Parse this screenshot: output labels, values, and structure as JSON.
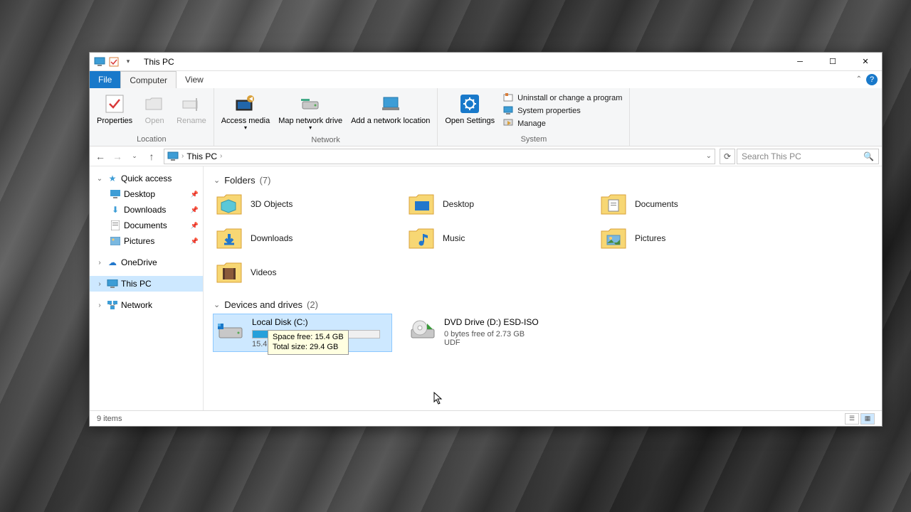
{
  "title": "This PC",
  "tabs": {
    "file": "File",
    "computer": "Computer",
    "view": "View"
  },
  "ribbon": {
    "location": {
      "label": "Location",
      "properties": "Properties",
      "open": "Open",
      "rename": "Rename"
    },
    "network": {
      "label": "Network",
      "access_media": "Access media",
      "map_drive": "Map network drive",
      "add_loc": "Add a network location"
    },
    "system": {
      "label": "System",
      "open_settings": "Open Settings",
      "uninstall": "Uninstall or change a program",
      "sys_props": "System properties",
      "manage": "Manage"
    }
  },
  "breadcrumb": "This PC",
  "search_placeholder": "Search This PC",
  "sidebar": {
    "quick_access": "Quick access",
    "desktop": "Desktop",
    "downloads": "Downloads",
    "documents": "Documents",
    "pictures": "Pictures",
    "onedrive": "OneDrive",
    "this_pc": "This PC",
    "network": "Network"
  },
  "sections": {
    "folders": {
      "label": "Folders",
      "count": "(7)"
    },
    "drives": {
      "label": "Devices and drives",
      "count": "(2)"
    }
  },
  "folders": {
    "f0": "3D Objects",
    "f1": "Desktop",
    "f2": "Documents",
    "f3": "Downloads",
    "f4": "Music",
    "f5": "Pictures",
    "f6": "Videos"
  },
  "drives": {
    "c": {
      "name": "Local Disk (C:)",
      "free_text": "15.4",
      "tooltip_line1": "Space free: 15.4 GB",
      "tooltip_line2": "Total size: 29.4 GB"
    },
    "d": {
      "name": "DVD Drive (D:) ESD-ISO",
      "sub1": "0 bytes free of 2.73 GB",
      "sub2": "UDF"
    }
  },
  "status": "9 items"
}
